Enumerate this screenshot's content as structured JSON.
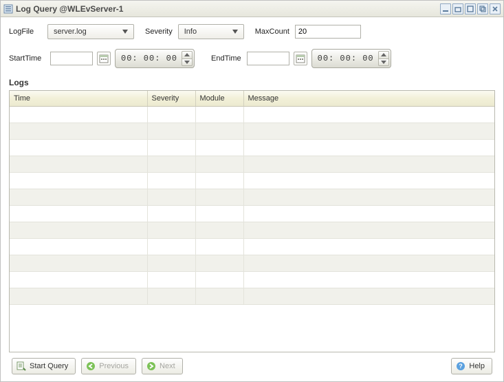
{
  "title": "Log Query @WLEvServer-1",
  "filters": {
    "logfile_label": "LogFile",
    "logfile_value": "server.log",
    "severity_label": "Severity",
    "severity_value": "Info",
    "maxcount_label": "MaxCount",
    "maxcount_value": "20",
    "starttime_label": "StartTime",
    "starttime_value": "",
    "starttime_time": "00: 00: 00",
    "endtime_label": "EndTime",
    "endtime_value": "",
    "endtime_time": "00: 00: 00"
  },
  "section_label": "Logs",
  "columns": {
    "time": "Time",
    "severity": "Severity",
    "module": "Module",
    "message": "Message"
  },
  "rows": [
    {
      "time": "",
      "severity": "",
      "module": "",
      "message": ""
    },
    {
      "time": "",
      "severity": "",
      "module": "",
      "message": ""
    },
    {
      "time": "",
      "severity": "",
      "module": "",
      "message": ""
    },
    {
      "time": "",
      "severity": "",
      "module": "",
      "message": ""
    },
    {
      "time": "",
      "severity": "",
      "module": "",
      "message": ""
    },
    {
      "time": "",
      "severity": "",
      "module": "",
      "message": ""
    },
    {
      "time": "",
      "severity": "",
      "module": "",
      "message": ""
    },
    {
      "time": "",
      "severity": "",
      "module": "",
      "message": ""
    },
    {
      "time": "",
      "severity": "",
      "module": "",
      "message": ""
    },
    {
      "time": "",
      "severity": "",
      "module": "",
      "message": ""
    },
    {
      "time": "",
      "severity": "",
      "module": "",
      "message": ""
    },
    {
      "time": "",
      "severity": "",
      "module": "",
      "message": ""
    }
  ],
  "footer": {
    "start_query": "Start Query",
    "previous": "Previous",
    "next": "Next",
    "help": "Help"
  }
}
